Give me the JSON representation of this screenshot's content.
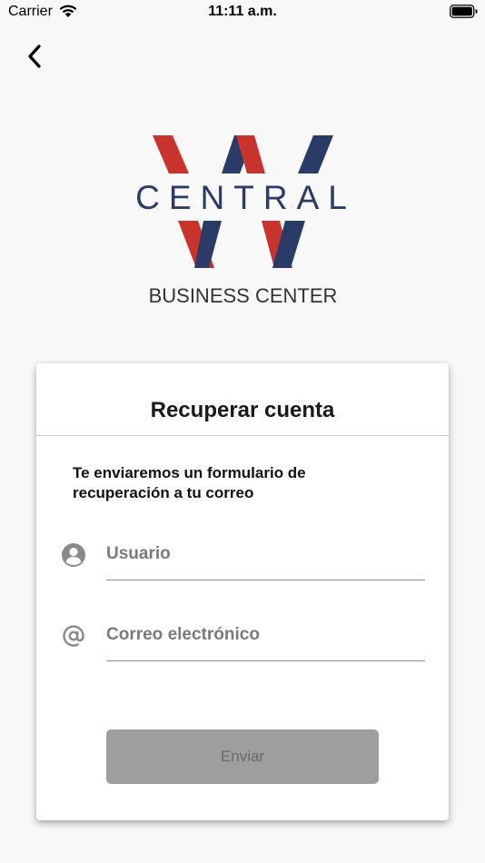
{
  "status_bar": {
    "carrier": "Carrier",
    "time": "11:11 a.m.",
    "icons": [
      "wifi-icon",
      "battery-icon"
    ]
  },
  "nav": {
    "back_icon": "chevron-left-icon"
  },
  "logo": {
    "name": "CENTRAL",
    "subtitle": "BUSINESS CENTER",
    "colors": {
      "red": "#c8342c",
      "navy": "#2b3b68"
    }
  },
  "card": {
    "title": "Recuperar cuenta",
    "description": "Te enviaremos un formulario de recuperación a tu correo",
    "fields": [
      {
        "icon": "user-circle-icon",
        "placeholder": "Usuario",
        "value": ""
      },
      {
        "icon": "at-sign-icon",
        "placeholder": "Correo electrónico",
        "value": ""
      }
    ],
    "submit_label": "Enviar",
    "colors": {
      "button_bg": "#9e9e9e",
      "button_text": "#6a6a6a"
    }
  }
}
